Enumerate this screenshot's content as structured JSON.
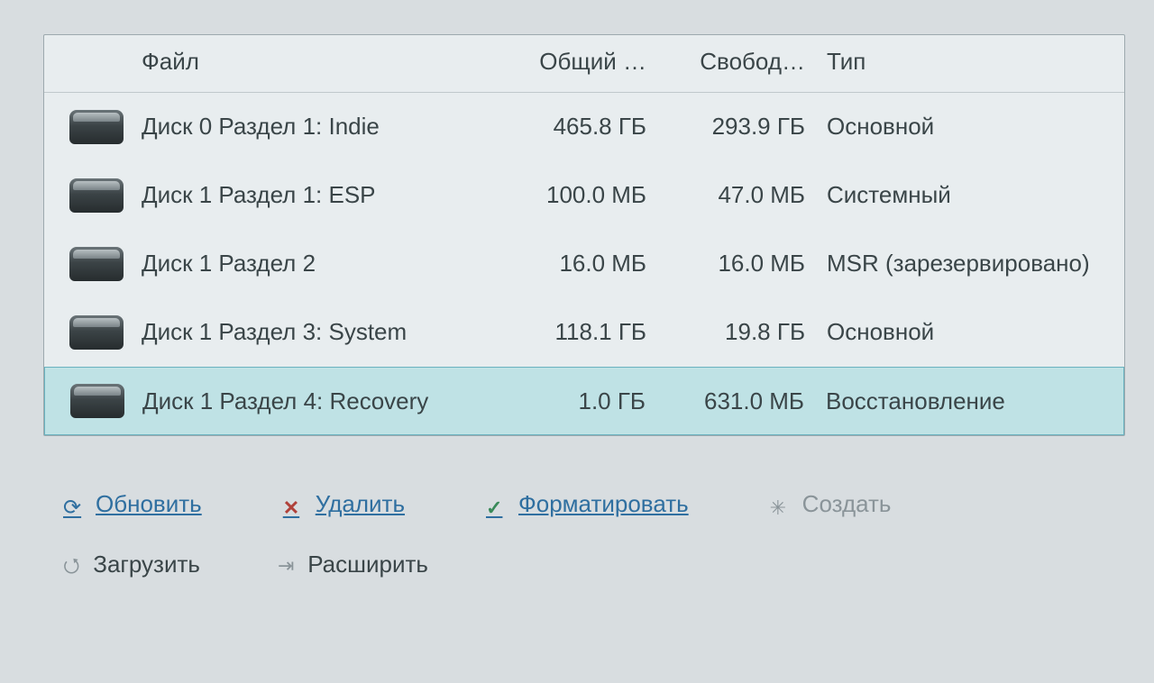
{
  "columns": {
    "name": "Файл",
    "total": "Общий …",
    "free": "Свобод…",
    "type": "Тип"
  },
  "rows": [
    {
      "name": "Диск 0 Раздел 1: Indie",
      "total": "465.8 ГБ",
      "free": "293.9 ГБ",
      "type": "Основной",
      "selected": false
    },
    {
      "name": "Диск 1 Раздел 1: ESP",
      "total": "100.0 МБ",
      "free": "47.0 МБ",
      "type": "Системный",
      "selected": false
    },
    {
      "name": "Диск 1 Раздел 2",
      "total": "16.0 МБ",
      "free": "16.0 МБ",
      "type": "MSR (зарезервировано)",
      "selected": false
    },
    {
      "name": "Диск 1 Раздел 3: System",
      "total": "118.1 ГБ",
      "free": "19.8 ГБ",
      "type": "Основной",
      "selected": false
    },
    {
      "name": "Диск 1 Раздел 4: Recovery",
      "total": "1.0 ГБ",
      "free": "631.0 МБ",
      "type": "Восстановление",
      "selected": true
    }
  ],
  "toolbar": {
    "refresh": "Обновить",
    "delete": "Удалить",
    "format": "Форматировать",
    "new": "Создать",
    "load": "Загрузить",
    "extend": "Расширить"
  }
}
